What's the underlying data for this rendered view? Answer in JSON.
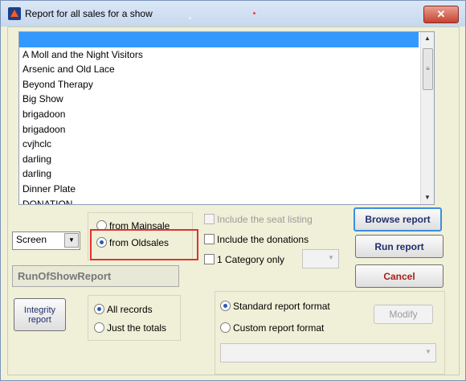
{
  "window": {
    "title": "Report for all sales for a show",
    "close_glyph": "✕",
    "app_icon": "app-icon"
  },
  "show_list": {
    "items": [
      "",
      "A Moll and the Night Visitors",
      "Arsenic and Old Lace",
      "Beyond Therapy",
      "Big Show",
      "brigadoon",
      "brigadoon",
      "cvjhclc",
      "darling",
      "darling",
      "Dinner Plate",
      "DONATION"
    ],
    "selected_index": 0
  },
  "output": {
    "selected": "Screen"
  },
  "source": {
    "mainsale_label": "from Mainsale",
    "oldsales_label": "from Oldsales",
    "selected": "from Oldsales"
  },
  "report_name": "RunOfShowReport",
  "options": {
    "seat_listing_label": "Include the seat listing",
    "donations_label": "Include the donations",
    "category_only_label": "1 Category only"
  },
  "buttons": {
    "browse_report": "Browse report",
    "run_report": "Run report",
    "cancel": "Cancel",
    "integrity_report": "Integrity report",
    "modify": "Modify"
  },
  "records": {
    "all_label": "All records",
    "totals_label": "Just the totals",
    "selected": "All records"
  },
  "format": {
    "standard_label": "Standard report format",
    "custom_label": "Custom report format",
    "selected": "Standard report format"
  },
  "colors": {
    "selection_blue": "#3399ff",
    "highlight_red": "#e03030",
    "dialog_bg": "#f0f0d8"
  }
}
